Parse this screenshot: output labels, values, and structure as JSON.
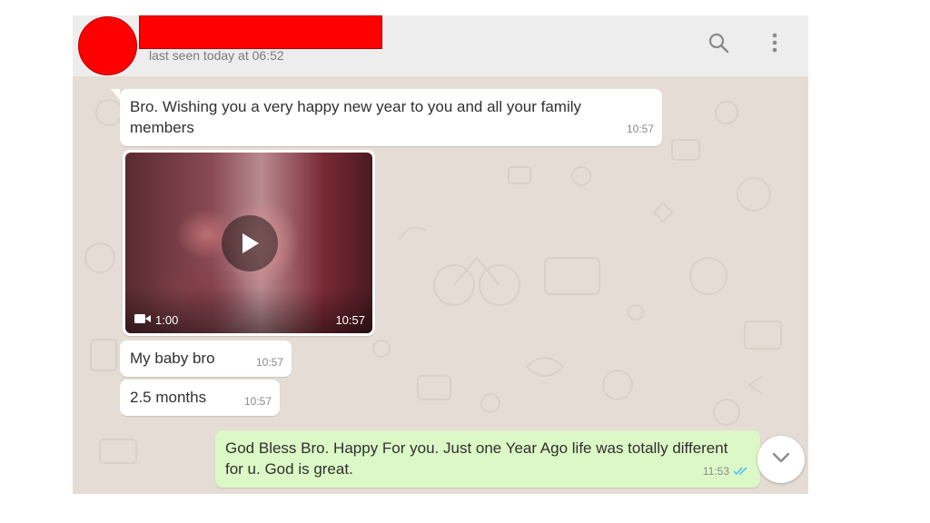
{
  "header": {
    "last_seen": "last seen today at 06:52",
    "icons": [
      "search-icon",
      "menu-dots-icon"
    ]
  },
  "messages": [
    {
      "type": "incoming",
      "text": "Bro. Wishing you a very happy new year to you and all your family members",
      "time": "10:57"
    },
    {
      "type": "incoming-video",
      "duration": "1:00",
      "time": "10:57",
      "icon": "video-camera-icon"
    },
    {
      "type": "incoming",
      "text": "My baby bro",
      "time": "10:57"
    },
    {
      "type": "incoming",
      "text": "2.5 months",
      "time": "10:57"
    },
    {
      "type": "outgoing",
      "text": "God Bless Bro. Happy For you. Just one Year Ago life was totally different for u. God is great.",
      "time": "11:53",
      "status": "read",
      "status_icon": "double-check-icon"
    }
  ],
  "colors": {
    "chat_background": "#e5ddd5",
    "header_background": "#ededed",
    "incoming_bubble": "#ffffff",
    "outgoing_bubble": "#dcf8c6",
    "read_ticks": "#4fc3f7",
    "redaction": "#ff0000"
  }
}
